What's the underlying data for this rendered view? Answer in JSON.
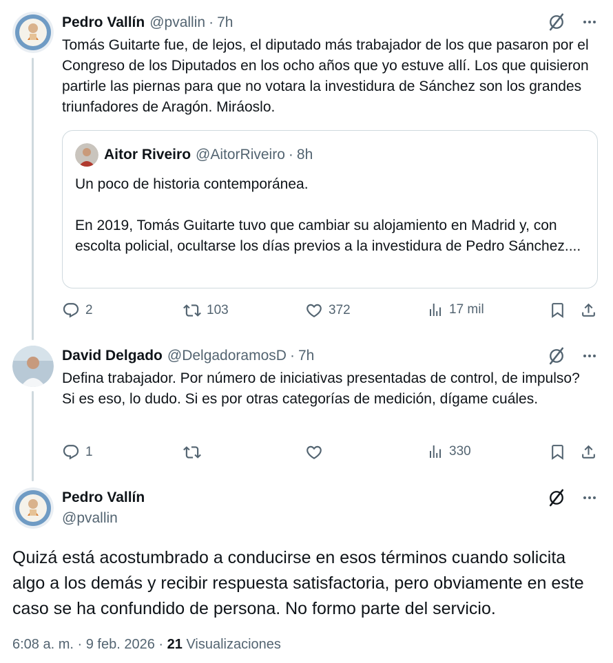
{
  "colors": {
    "text_primary": "#0f1419",
    "text_secondary": "#536471",
    "border": "#cfd9de",
    "background": "#ffffff"
  },
  "tweet1": {
    "name": "Pedro Vallín",
    "handle": "@pvallin",
    "separator": "·",
    "time": "7h",
    "text": "Tomás Guitarte fue, de lejos, el diputado más trabajador de los que pasaron por el Congreso de los Diputados en los ocho años que yo estuve allí. Los que quisieron partirle las piernas para que no votara la investidura de Sánchez son los grandes triunfadores de Aragón. Miráoslo.",
    "quote": {
      "name": "Aitor Riveiro",
      "handle": "@AitorRiveiro",
      "separator": "·",
      "time": "8h",
      "text": "Un poco de historia contemporánea.\n\nEn 2019, Tomás Guitarte tuvo que cambiar su alojamiento en Madrid y, con escolta policial, ocultarse los días previos a la investidura de Pedro Sánchez...."
    },
    "actions": {
      "replies": "2",
      "reposts": "103",
      "likes": "372",
      "views": "17 mil"
    }
  },
  "tweet2": {
    "name": "David Delgado",
    "handle": "@DelgadoramosD",
    "separator": "·",
    "time": "7h",
    "text": "Defina trabajador. Por número de iniciativas presentadas de control, de impulso? Si es eso, lo dudo. Si es por otras categorías de medición, dígame cuáles.",
    "actions": {
      "replies": "1",
      "reposts": "",
      "likes": "",
      "views": "330"
    }
  },
  "main_tweet": {
    "name": "Pedro Vallín",
    "handle": "@pvallin",
    "text": "Quizá está acostumbrado a conducirse en esos términos cuando solicita algo a los demás y recibir respuesta satisfactoria, pero obviamente en este caso se ha confundido de persona. No formo parte del servicio.",
    "time": "6:08 a. m.",
    "separator": "·",
    "date": "9 feb. 2026",
    "views_count": "21",
    "views_label": "Visualizaciones"
  },
  "icons": {
    "grok": "grok-icon",
    "more": "more-icon",
    "reply": "reply-icon",
    "repost": "repost-icon",
    "like": "heart-icon",
    "views": "views-icon",
    "bookmark": "bookmark-icon",
    "share": "share-icon"
  }
}
